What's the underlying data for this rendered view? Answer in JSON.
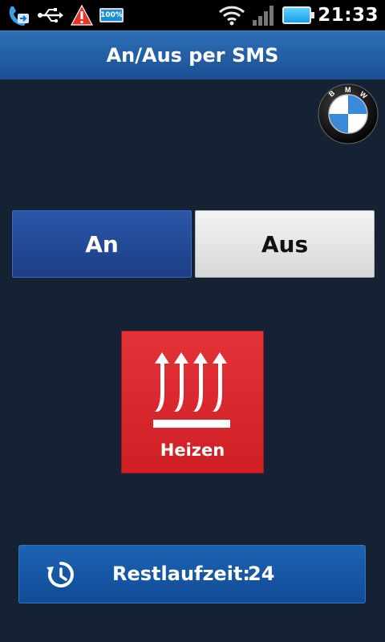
{
  "status_bar": {
    "time": "21:33",
    "battery_small_label": "100%",
    "icons": [
      "phone-forward-icon",
      "usb-icon",
      "warning-icon",
      "battery-small-icon",
      "wifi-icon",
      "signal-icon",
      "battery-icon"
    ]
  },
  "header": {
    "title": "An/Aus per SMS"
  },
  "logo": {
    "name": "BMW",
    "letters": [
      "B",
      "M",
      "W"
    ]
  },
  "toggle": {
    "on_label": "An",
    "off_label": "Aus",
    "selected": "An"
  },
  "mode": {
    "label": "Heizen",
    "icon": "heat-arrows-icon"
  },
  "remaining": {
    "label": "Restlaufzeit:",
    "value": "24",
    "icon": "refresh-timer-icon"
  },
  "colors": {
    "background": "#142233",
    "title_bar": "#1b4f93",
    "toggle_selected": "#1c3e86",
    "heizen": "#d8262c",
    "rest_bar": "#1559a7"
  }
}
